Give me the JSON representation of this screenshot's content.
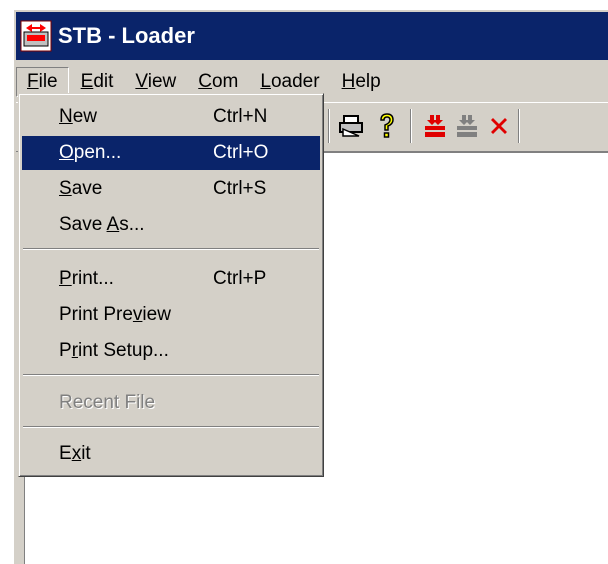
{
  "title": "STB - Loader",
  "menubar": [
    {
      "label": "File",
      "ul": "F",
      "rest": "ile"
    },
    {
      "label": "Edit",
      "ul": "E",
      "rest": "dit"
    },
    {
      "label": "View",
      "ul": "V",
      "rest": "iew"
    },
    {
      "label": "Com",
      "ul": "C",
      "rest": "om"
    },
    {
      "label": "Loader",
      "ul": "L",
      "rest": "oader"
    },
    {
      "label": "Help",
      "ul": "H",
      "rest": "elp"
    }
  ],
  "file_menu": {
    "new": {
      "label": "New",
      "shortcut": "Ctrl+N"
    },
    "open": {
      "label": "Open...",
      "shortcut": "Ctrl+O"
    },
    "save": {
      "label": "Save",
      "shortcut": "Ctrl+S"
    },
    "save_as": {
      "label": "Save As..."
    },
    "print": {
      "label": "Print...",
      "shortcut": "Ctrl+P"
    },
    "print_preview": {
      "label": "Print Preview"
    },
    "print_setup": {
      "label": "Print Setup..."
    },
    "recent_file": {
      "label": "Recent File"
    },
    "exit": {
      "label": "Exit"
    }
  },
  "toolbar_icons": [
    "printer-icon",
    "help-icon",
    "loader-load-icon",
    "loader-disabled-icon",
    "close-icon"
  ],
  "colors": {
    "titlebar": "#0a246a",
    "face": "#d4d0c8",
    "highlight": "#0a246a",
    "red": "#e00000"
  }
}
